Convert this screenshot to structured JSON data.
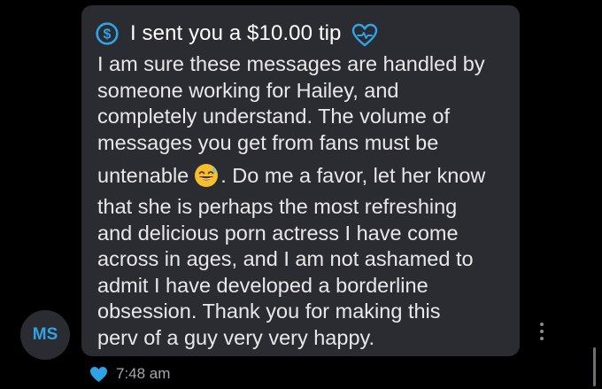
{
  "message": {
    "tip_label": "I sent you a $10.00 tip",
    "tip_icon": "dollar-circle-icon",
    "tip_reaction_icon": "heart-outline-icon",
    "lines": [
      "I am sure these messages are handled by",
      "someone working for Hailey, and",
      "completely understand. The volume of",
      "messages you get from fans must be"
    ],
    "emoji_line_before": "untenable",
    "emoji_line_after": ". Do me a favor, let her know",
    "emoji": "grinning-face-with-sweat-emoji",
    "lines_after": [
      "that she is perhaps the most refreshing",
      "and delicious porn actress I have come",
      "across in ages, and I am not ashamed to",
      "admit I have developed a borderline",
      "obsession. Thank you for making this",
      "perv of a guy very very happy."
    ]
  },
  "sender": {
    "initials": "MS"
  },
  "footer": {
    "liked_icon": "heart-filled-icon",
    "time": "7:48 am"
  },
  "colors": {
    "background": "#000000",
    "bubble": "#2b2c31",
    "accent": "#2fa3e6",
    "text": "#e8e8ea",
    "muted": "#a5a6ac"
  },
  "menu_icon": "more-vertical-icon"
}
